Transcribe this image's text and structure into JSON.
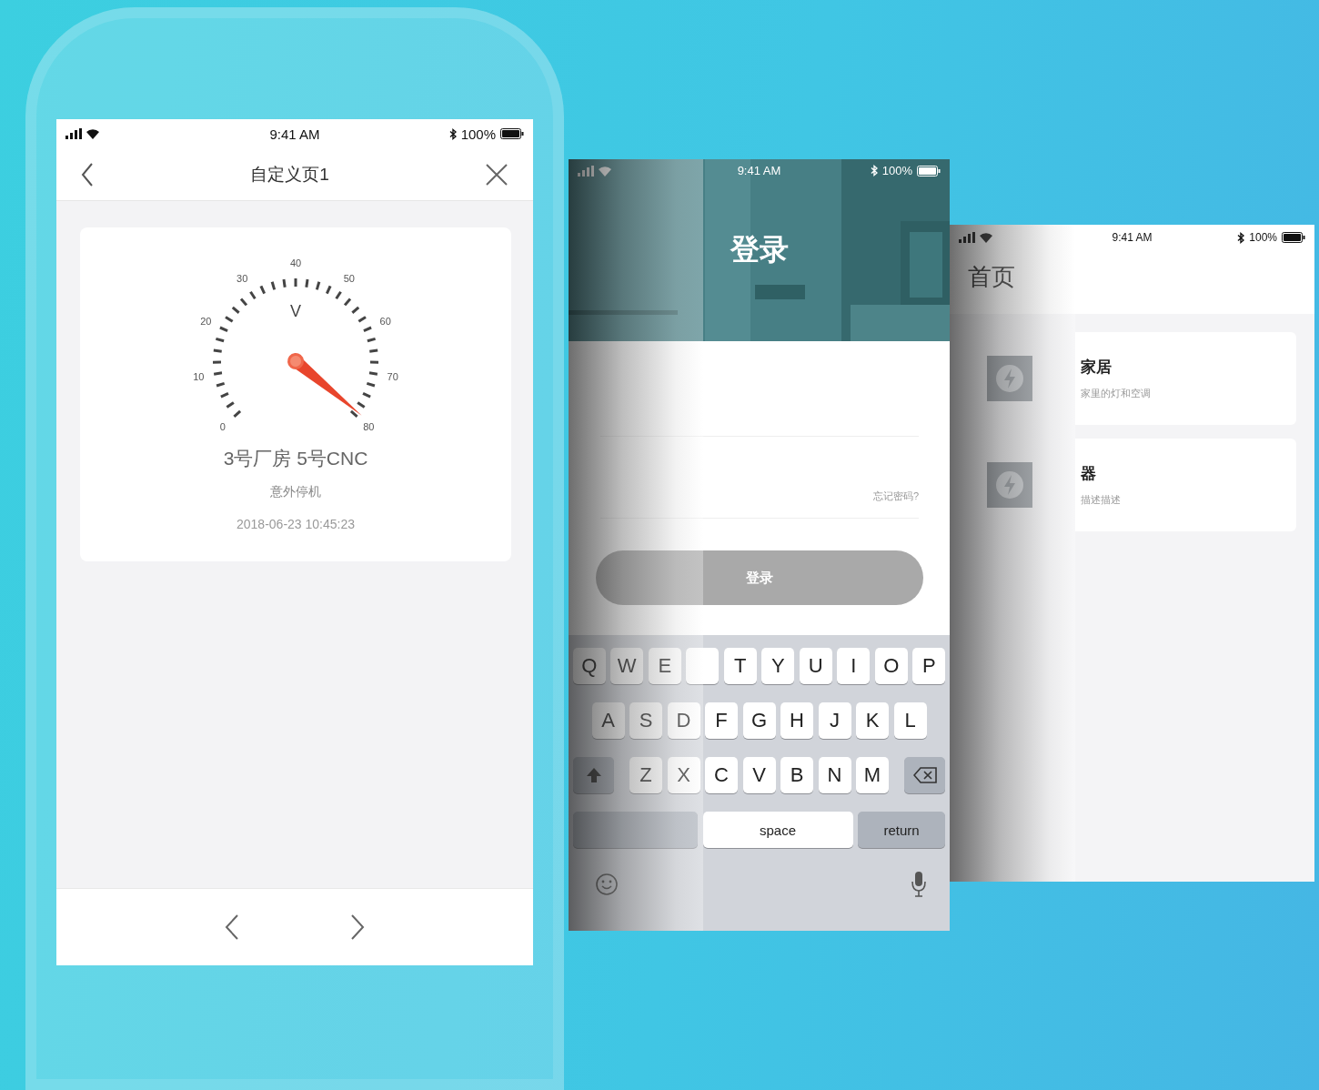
{
  "left_screen": {
    "status_bar": {
      "time": "9:41 AM",
      "battery": "100%"
    },
    "nav": {
      "title": "自定义页1"
    },
    "gauge": {
      "unit": "V",
      "level": 0.99,
      "labels": [
        "0",
        "10",
        "20",
        "30",
        "40",
        "50",
        "60",
        "70",
        "80"
      ]
    },
    "device": {
      "name": "3号厂房 5号CNC",
      "status": "意外停机",
      "time": "2018-06-23 10:45:23"
    }
  },
  "login_screen": {
    "status_bar": {
      "time": "9:41 AM",
      "battery": "100%"
    },
    "title": "登录",
    "forgot_link": "忘记密码?",
    "login_button": "登录",
    "keyboard": {
      "letter_rows": [
        [
          {
            "kind": "letter",
            "label": "Q"
          },
          {
            "kind": "letter",
            "label": "W"
          },
          {
            "kind": "letter",
            "label": "E"
          },
          {
            "kind": "blank"
          },
          {
            "kind": "letter",
            "label": "T"
          },
          {
            "kind": "letter",
            "label": "Y"
          },
          {
            "kind": "letter",
            "label": "U"
          },
          {
            "kind": "letter",
            "label": "I"
          },
          {
            "kind": "letter",
            "label": "O"
          },
          {
            "kind": "letter",
            "label": "P"
          }
        ],
        [
          {
            "kind": "letter",
            "label": "A"
          },
          {
            "kind": "letter",
            "label": "S"
          },
          {
            "kind": "letter",
            "label": "D"
          },
          {
            "kind": "letter",
            "label": "F"
          },
          {
            "kind": "letter",
            "label": "G"
          },
          {
            "kind": "letter",
            "label": "H"
          },
          {
            "kind": "letter",
            "label": "J"
          },
          {
            "kind": "letter",
            "label": "K"
          },
          {
            "kind": "letter",
            "label": "L"
          }
        ],
        [
          {
            "kind": "shift"
          },
          {
            "kind": "letter",
            "label": "Z"
          },
          {
            "kind": "letter",
            "label": "X"
          },
          {
            "kind": "letter",
            "label": "C"
          },
          {
            "kind": "letter",
            "label": "V"
          },
          {
            "kind": "letter",
            "label": "B"
          },
          {
            "kind": "letter",
            "label": "N"
          },
          {
            "kind": "letter",
            "label": "M"
          },
          {
            "kind": "backspace"
          }
        ]
      ],
      "space_key": "space",
      "return_key": "return"
    }
  },
  "home_screen": {
    "status_bar": {
      "time": "9:41 AM",
      "battery": "100%"
    },
    "title": "首页",
    "cards": [
      {
        "title": "家居",
        "subtitle": "家里的灯和空调"
      },
      {
        "title": "器",
        "subtitle": "描述描述"
      }
    ]
  }
}
